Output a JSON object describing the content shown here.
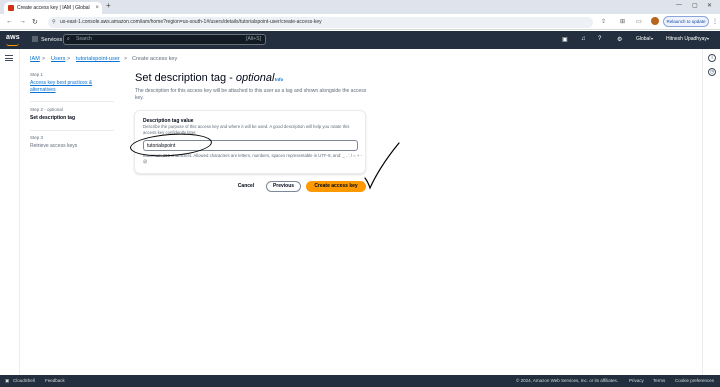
{
  "browser": {
    "tab_title": "Create access key | IAM | Global",
    "tab_close": "×",
    "new_tab": "+",
    "url": "us-east-1.console.aws.amazon.com/iam/home?region=us-south-1#/users/details/tutorialspoint-user/create-access-key",
    "relaunch_label": "Relaunch to update"
  },
  "awsnav": {
    "logo": "aws",
    "services_label": "Services",
    "search_placeholder": "Search",
    "search_shortcut": "[Alt+S]",
    "region": "Global",
    "account": "Hitnesh Upadhyay"
  },
  "breadcrumb": {
    "iam": "IAM",
    "users": "Users",
    "user": "tutorialspoint-user",
    "current": "Create access key",
    "separator": ">"
  },
  "steps": [
    {
      "num": "Step 1",
      "label": "Access key best practices & alternatives",
      "state": "link"
    },
    {
      "num": "Step 2 - optional",
      "label": "Set description tag",
      "state": "active"
    },
    {
      "num": "Step 3",
      "label": "Retrieve access keys",
      "state": "off"
    }
  ],
  "main": {
    "title_prefix": "Set description tag - ",
    "title_optional": "optional",
    "info": "Info",
    "description": "The description for this access key will be attached to this user as a tag and shown alongside the access key.",
    "field_label": "Description tag value",
    "field_description": "Describe the purpose of this access key and where it will be used. A good description will help you rotate this access key confidently later.",
    "field_value": "tutorialspoint",
    "field_constraint": "Maximum 256 characters. Allowed characters are letters, numbers, spaces representable in UTF-8, and: _ . : / = + - @"
  },
  "actions": {
    "cancel": "Cancel",
    "previous": "Previous",
    "create": "Create access key"
  },
  "footer": {
    "cloudshell": "CloudShell",
    "feedback": "Feedback",
    "copyright": "© 2024, Amazon Web Services, Inc. or its affiliates.",
    "privacy": "Privacy",
    "terms": "Terms",
    "cookie": "Cookie preferences"
  },
  "colors": {
    "aws_nav": "#232f3e",
    "primary_button": "#ff9900",
    "link": "#0972d3"
  }
}
